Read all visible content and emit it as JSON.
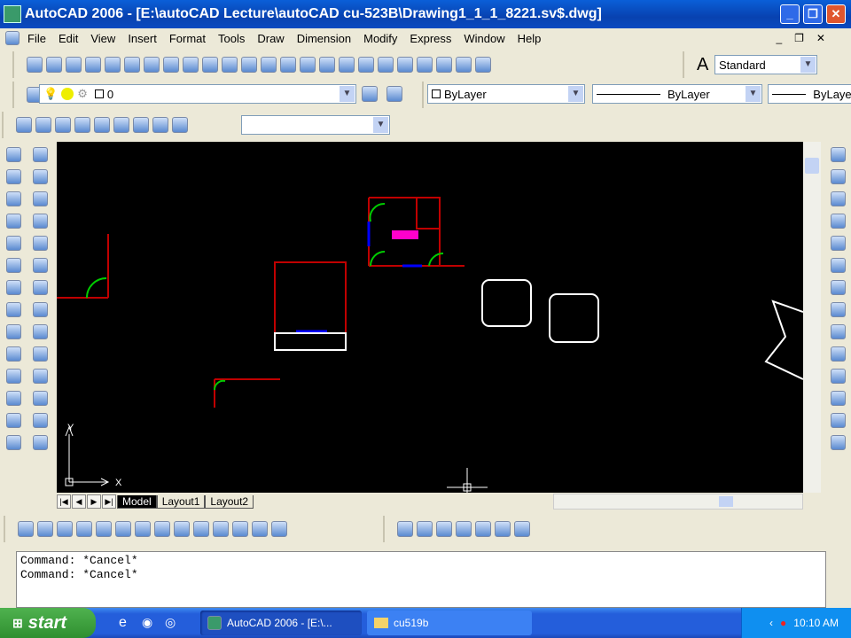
{
  "window": {
    "title": "AutoCAD 2006 - [E:\\autoCAD Lecture\\autoCAD cu-523B\\Drawing1_1_1_8221.sv$.dwg]"
  },
  "menu": [
    "File",
    "Edit",
    "View",
    "Insert",
    "Format",
    "Tools",
    "Draw",
    "Dimension",
    "Modify",
    "Express",
    "Window",
    "Help"
  ],
  "standard_toolbar": {
    "icons": [
      "new-icon",
      "open-icon",
      "save-icon",
      "plot-icon",
      "plot-preview-icon",
      "publish-icon",
      "cut-icon",
      "copy-icon",
      "paste-icon",
      "match-properties-icon",
      "block-editor-icon",
      "undo-icon",
      "redo-icon",
      "pan-icon",
      "zoom-realtime-icon",
      "zoom-window-icon",
      "zoom-previous-icon",
      "properties-icon",
      "design-center-icon",
      "tool-palettes-icon",
      "sheet-set-icon",
      "markup-icon",
      "calculator-icon",
      "help-icon"
    ],
    "text_style": "Standard"
  },
  "layers": {
    "current_layer": "0"
  },
  "properties": {
    "color": "ByLayer",
    "linetype": "ByLayer",
    "lineweight": "ByLayer"
  },
  "render_toolbar": {
    "icons": [
      "pan-icon",
      "zoom-icon",
      "orbit-icon",
      "free-orbit-icon",
      "camera-icon",
      "views-icon",
      "ucs-icon",
      "box-icon",
      "ucs-world-icon"
    ],
    "value": ""
  },
  "left_toolbar_1": [
    "box-icon",
    "cube-icon",
    "wedge-icon",
    "extrude-icon",
    "revolve-icon",
    "slice-icon",
    "section-icon",
    "union-icon",
    "subtract-icon",
    "intersect-icon",
    "sphere-icon",
    "torus-icon",
    "mesh-icon",
    "line-icon"
  ],
  "left_toolbar_2": [
    "flag-icon",
    "eraser-icon",
    "cube-outline-icon",
    "pyramid-icon",
    "cone-icon",
    "triangle-icon",
    "dome-icon",
    "dish-icon",
    "torus-outline-icon",
    "diamond-icon",
    "polyface-icon",
    "mesh-outline-icon",
    "spiral-icon",
    "hatch-icon"
  ],
  "right_toolbar": [
    "link-icon",
    "link-icon",
    "link-icon",
    "box-3d-icon",
    "move-3d-icon",
    "copy-3d-icon",
    "erase-icon",
    "rotate-icon",
    "align-icon",
    "stack-icon",
    "layers-icon",
    "cube-icon",
    "cube-icon",
    "cube-icon"
  ],
  "solids_toolbar": [
    "box-icon",
    "sphere-icon",
    "cylinder-icon",
    "cone-icon",
    "wedge-icon",
    "torus-icon",
    "extrude-icon",
    "revolve-icon",
    "slice-icon",
    "section-icon",
    "interfere-icon",
    "setup-drawing-icon",
    "setup-view-icon",
    "setup-profile-icon"
  ],
  "views_toolbar": [
    "2d-wireframe-icon",
    "3d-wireframe-icon",
    "hidden-icon",
    "flat-shaded-icon",
    "gouraud-icon",
    "flat-edges-icon",
    "gouraud-edges-icon"
  ],
  "ucs": {
    "x": "X",
    "y": "Y"
  },
  "layout_tabs": [
    "Model",
    "Layout1",
    "Layout2"
  ],
  "command": {
    "lines": [
      "Command: *Cancel*",
      "Command: *Cancel*"
    ]
  },
  "taskbar": {
    "start": "start",
    "tasks": [
      "AutoCAD 2006 - [E:\\...",
      "cu519b"
    ],
    "clock": "10:10 AM"
  }
}
